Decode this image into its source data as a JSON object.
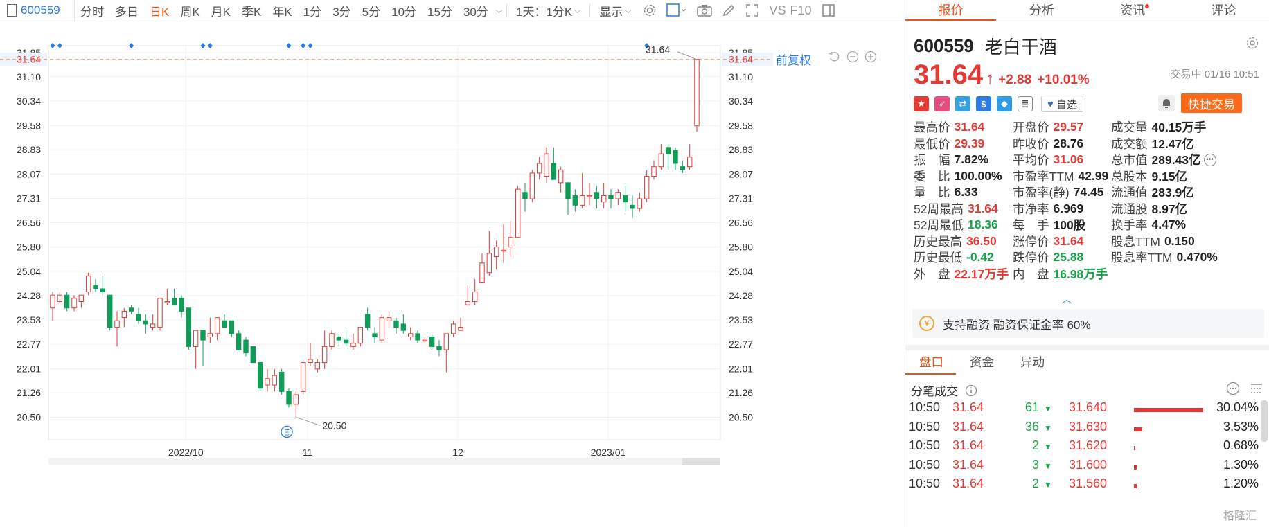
{
  "toolbar": {
    "code": "600559",
    "periods": [
      "分时",
      "多日",
      "日K",
      "周K",
      "月K",
      "季K",
      "年K",
      "1分",
      "3分",
      "5分",
      "10分",
      "15分",
      "30分"
    ],
    "active_period": "日K",
    "multi": "1天：1分K",
    "display": "显示",
    "vs": "VS",
    "f10": "F10"
  },
  "adjust_label": "前复权",
  "right": {
    "tabs": [
      "报价",
      "分析",
      "资讯",
      "评论"
    ],
    "code": "600559",
    "name": "老白干酒",
    "price": "31.64",
    "change": "+2.88",
    "pct": "+10.01%",
    "status": "交易中 01/16 10:51",
    "watch": "自选",
    "quick": "快捷交易",
    "margin_text": "支持融资 融资保证金率 60%",
    "margin_icon": "¥",
    "sub_tabs": [
      "盘口",
      "资金",
      "异动"
    ],
    "tick_title": "分笔成交",
    "watermark": "格隆汇"
  },
  "quote": [
    [
      {
        "k": "最高价",
        "v": "31.64",
        "c": "up"
      },
      {
        "k": "开盘价",
        "v": "29.57",
        "c": "up"
      },
      {
        "k": "成交量",
        "v": "40.15万手",
        "c": "nt"
      }
    ],
    [
      {
        "k": "最低价",
        "v": "29.39",
        "c": "up"
      },
      {
        "k": "昨收价",
        "v": "28.76",
        "c": "nt"
      },
      {
        "k": "成交额",
        "v": "12.47亿",
        "c": "nt"
      }
    ],
    [
      {
        "k": "振　幅",
        "v": "7.82%",
        "c": "nt"
      },
      {
        "k": "平均价",
        "v": "31.06",
        "c": "up"
      },
      {
        "k": "总市值",
        "v": "289.43亿",
        "c": "nt"
      }
    ],
    [
      {
        "k": "委　比",
        "v": "100.00%",
        "c": "nt"
      },
      {
        "k": "市盈率TTM",
        "v": "42.99",
        "c": "nt"
      },
      {
        "k": "总股本",
        "v": "9.15亿",
        "c": "nt"
      }
    ],
    [
      {
        "k": "量　比",
        "v": "6.33",
        "c": "nt"
      },
      {
        "k": "市盈率(静)",
        "v": "74.45",
        "c": "nt"
      },
      {
        "k": "流通值",
        "v": "283.9亿",
        "c": "nt"
      }
    ],
    [
      {
        "k": "52周最高",
        "v": "31.64",
        "c": "up"
      },
      {
        "k": "市净率",
        "v": "6.969",
        "c": "nt"
      },
      {
        "k": "流通股",
        "v": "8.97亿",
        "c": "nt"
      }
    ],
    [
      {
        "k": "52周最低",
        "v": "18.36",
        "c": "dn"
      },
      {
        "k": "每　手",
        "v": "100股",
        "c": "nt"
      },
      {
        "k": "换手率",
        "v": "4.47%",
        "c": "nt"
      }
    ],
    [
      {
        "k": "历史最高",
        "v": "36.50",
        "c": "up"
      },
      {
        "k": "涨停价",
        "v": "31.64",
        "c": "up"
      },
      {
        "k": "股息TTM",
        "v": "0.150",
        "c": "nt"
      }
    ],
    [
      {
        "k": "历史最低",
        "v": "-0.42",
        "c": "dn"
      },
      {
        "k": "跌停价",
        "v": "25.88",
        "c": "dn"
      },
      {
        "k": "股息率TTM",
        "v": "0.470%",
        "c": "nt"
      }
    ],
    [
      {
        "k": "外　盘",
        "v": "22.17万手",
        "c": "up"
      },
      {
        "k": "内　盘",
        "v": "16.98万手",
        "c": "dn"
      }
    ]
  ],
  "ticks": [
    {
      "time": "10:50",
      "price": "31.64",
      "vol": "61",
      "price2": "31.640",
      "pct": "30.04%",
      "bar": 0.3004
    },
    {
      "time": "10:50",
      "price": "31.64",
      "vol": "36",
      "price2": "31.630",
      "pct": "3.53%",
      "bar": 0.0353
    },
    {
      "time": "10:50",
      "price": "31.64",
      "vol": "2",
      "price2": "31.620",
      "pct": "0.68%",
      "bar": 0.0068
    },
    {
      "time": "10:50",
      "price": "31.64",
      "vol": "3",
      "price2": "31.600",
      "pct": "1.30%",
      "bar": 0.013
    },
    {
      "time": "10:50",
      "price": "31.64",
      "vol": "2",
      "price2": "31.560",
      "pct": "1.20%",
      "bar": 0.012
    }
  ],
  "chart_data": {
    "type": "candlestick",
    "y_ticks": [
      "31.85",
      "31.64",
      "31.10",
      "30.34",
      "29.58",
      "28.83",
      "28.07",
      "27.31",
      "26.56",
      "25.80",
      "25.04",
      "24.28",
      "23.53",
      "22.77",
      "22.01",
      "21.26",
      "20.50"
    ],
    "ylim": [
      20.1,
      31.85
    ],
    "x_labels": [
      {
        "label": "2022/10",
        "i": 19
      },
      {
        "label": "11",
        "i": 36
      },
      {
        "label": "12",
        "i": 57
      },
      {
        "label": "2023/01",
        "i": 78
      }
    ],
    "last_price": "31.64",
    "high_label": "31.64",
    "low_label": "20.50",
    "event_label": "E",
    "event_index": 33,
    "low_index": 34,
    "markers": [
      0,
      1,
      11,
      21,
      22,
      33,
      35,
      36,
      83
    ],
    "candles": [
      {
        "o": 23.9,
        "c": 24.3,
        "h": 24.4,
        "l": 23.5
      },
      {
        "o": 24.1,
        "c": 24.3,
        "h": 24.4,
        "l": 24.0
      },
      {
        "o": 24.3,
        "c": 23.9,
        "h": 24.4,
        "l": 23.8
      },
      {
        "o": 23.9,
        "c": 24.2,
        "h": 24.3,
        "l": 23.8
      },
      {
        "o": 24.1,
        "c": 24.3,
        "h": 24.3,
        "l": 23.9
      },
      {
        "o": 24.4,
        "c": 24.9,
        "h": 25.0,
        "l": 24.3
      },
      {
        "o": 24.6,
        "c": 24.5,
        "h": 24.8,
        "l": 24.4
      },
      {
        "o": 24.5,
        "c": 24.4,
        "h": 24.9,
        "l": 24.3
      },
      {
        "o": 24.3,
        "c": 23.3,
        "h": 24.3,
        "l": 23.2
      },
      {
        "o": 23.3,
        "c": 23.5,
        "h": 23.8,
        "l": 22.7
      },
      {
        "o": 23.6,
        "c": 23.8,
        "h": 23.9,
        "l": 23.3
      },
      {
        "o": 23.9,
        "c": 23.8,
        "h": 24.0,
        "l": 23.7
      },
      {
        "o": 23.7,
        "c": 23.5,
        "h": 23.9,
        "l": 23.4
      },
      {
        "o": 23.5,
        "c": 23.4,
        "h": 23.7,
        "l": 23.1
      },
      {
        "o": 23.3,
        "c": 23.4,
        "h": 23.7,
        "l": 23.2
      },
      {
        "o": 23.3,
        "c": 24.2,
        "h": 24.2,
        "l": 23.2
      },
      {
        "o": 24.1,
        "c": 24.1,
        "h": 24.5,
        "l": 24.0
      },
      {
        "o": 24.2,
        "c": 24.0,
        "h": 24.5,
        "l": 24.0
      },
      {
        "o": 24.2,
        "c": 23.8,
        "h": 24.3,
        "l": 23.6
      },
      {
        "o": 23.9,
        "c": 22.7,
        "h": 23.9,
        "l": 22.6
      },
      {
        "o": 22.7,
        "c": 23.2,
        "h": 23.2,
        "l": 22.0
      },
      {
        "o": 23.2,
        "c": 22.9,
        "h": 23.2,
        "l": 22.1
      },
      {
        "o": 23.0,
        "c": 23.1,
        "h": 23.6,
        "l": 22.8
      },
      {
        "o": 23.1,
        "c": 23.6,
        "h": 23.6,
        "l": 22.9
      },
      {
        "o": 23.5,
        "c": 23.3,
        "h": 23.7,
        "l": 23.3
      },
      {
        "o": 23.5,
        "c": 23.1,
        "h": 23.5,
        "l": 23.0
      },
      {
        "o": 23.1,
        "c": 22.6,
        "h": 23.2,
        "l": 22.6
      },
      {
        "o": 22.9,
        "c": 22.5,
        "h": 23.0,
        "l": 22.4
      },
      {
        "o": 22.7,
        "c": 22.2,
        "h": 22.7,
        "l": 22.2
      },
      {
        "o": 22.2,
        "c": 21.4,
        "h": 22.2,
        "l": 21.3
      },
      {
        "o": 21.5,
        "c": 21.7,
        "h": 22.0,
        "l": 21.3
      },
      {
        "o": 21.5,
        "c": 21.8,
        "h": 22.0,
        "l": 21.3
      },
      {
        "o": 21.9,
        "c": 21.3,
        "h": 22.0,
        "l": 21.2
      },
      {
        "o": 21.3,
        "c": 20.9,
        "h": 21.4,
        "l": 20.8
      },
      {
        "o": 20.9,
        "c": 21.2,
        "h": 21.3,
        "l": 20.5
      },
      {
        "o": 21.3,
        "c": 22.2,
        "h": 22.2,
        "l": 21.2
      },
      {
        "o": 22.2,
        "c": 22.3,
        "h": 22.8,
        "l": 22.1
      },
      {
        "o": 22.0,
        "c": 22.2,
        "h": 22.3,
        "l": 21.9
      },
      {
        "o": 22.2,
        "c": 22.7,
        "h": 23.2,
        "l": 22.0
      },
      {
        "o": 22.7,
        "c": 23.1,
        "h": 23.2,
        "l": 22.6
      },
      {
        "o": 23.0,
        "c": 22.9,
        "h": 23.1,
        "l": 22.7
      },
      {
        "o": 22.9,
        "c": 22.8,
        "h": 23.2,
        "l": 22.7
      },
      {
        "o": 22.7,
        "c": 22.8,
        "h": 23.1,
        "l": 22.6
      },
      {
        "o": 22.8,
        "c": 23.3,
        "h": 23.3,
        "l": 22.7
      },
      {
        "o": 23.7,
        "c": 23.3,
        "h": 23.9,
        "l": 23.2
      },
      {
        "o": 23.1,
        "c": 23.0,
        "h": 23.3,
        "l": 22.8
      },
      {
        "o": 22.9,
        "c": 23.6,
        "h": 23.7,
        "l": 22.8
      },
      {
        "o": 23.5,
        "c": 23.6,
        "h": 23.8,
        "l": 23.3
      },
      {
        "o": 23.5,
        "c": 23.3,
        "h": 23.6,
        "l": 23.1
      },
      {
        "o": 23.4,
        "c": 23.2,
        "h": 23.7,
        "l": 23.1
      },
      {
        "o": 23.0,
        "c": 23.1,
        "h": 23.3,
        "l": 22.9
      },
      {
        "o": 23.1,
        "c": 22.9,
        "h": 23.2,
        "l": 22.8
      },
      {
        "o": 22.9,
        "c": 22.9,
        "h": 23.0,
        "l": 22.8
      },
      {
        "o": 23.0,
        "c": 22.7,
        "h": 23.1,
        "l": 22.6
      },
      {
        "o": 22.7,
        "c": 22.6,
        "h": 22.9,
        "l": 22.4
      },
      {
        "o": 22.6,
        "c": 23.1,
        "h": 23.1,
        "l": 21.9
      },
      {
        "o": 23.1,
        "c": 23.4,
        "h": 23.5,
        "l": 23.0
      },
      {
        "o": 23.2,
        "c": 23.3,
        "h": 23.6,
        "l": 23.2
      },
      {
        "o": 24.0,
        "c": 24.1,
        "h": 24.6,
        "l": 24.0
      },
      {
        "o": 24.1,
        "c": 24.4,
        "h": 24.8,
        "l": 24.0
      },
      {
        "o": 24.7,
        "c": 25.3,
        "h": 25.6,
        "l": 24.7
      },
      {
        "o": 25.0,
        "c": 25.6,
        "h": 26.3,
        "l": 24.9
      },
      {
        "o": 25.5,
        "c": 25.8,
        "h": 26.0,
        "l": 25.1
      },
      {
        "o": 25.7,
        "c": 25.7,
        "h": 26.5,
        "l": 25.3
      },
      {
        "o": 25.8,
        "c": 26.1,
        "h": 26.6,
        "l": 25.5
      },
      {
        "o": 26.1,
        "c": 27.6,
        "h": 27.7,
        "l": 26.1
      },
      {
        "o": 27.5,
        "c": 27.3,
        "h": 27.8,
        "l": 26.9
      },
      {
        "o": 27.3,
        "c": 28.1,
        "h": 28.2,
        "l": 27.2
      },
      {
        "o": 28.1,
        "c": 28.4,
        "h": 28.6,
        "l": 27.9
      },
      {
        "o": 28.0,
        "c": 28.7,
        "h": 28.9,
        "l": 27.8
      },
      {
        "o": 28.4,
        "c": 27.9,
        "h": 28.9,
        "l": 27.9
      },
      {
        "o": 27.8,
        "c": 28.2,
        "h": 28.3,
        "l": 27.5
      },
      {
        "o": 27.8,
        "c": 27.3,
        "h": 27.8,
        "l": 26.8
      },
      {
        "o": 27.4,
        "c": 27.1,
        "h": 27.6,
        "l": 26.9
      },
      {
        "o": 27.1,
        "c": 27.4,
        "h": 28.1,
        "l": 27.0
      },
      {
        "o": 27.4,
        "c": 27.4,
        "h": 27.8,
        "l": 27.1
      },
      {
        "o": 27.5,
        "c": 27.3,
        "h": 27.7,
        "l": 27.0
      },
      {
        "o": 27.2,
        "c": 27.4,
        "h": 27.8,
        "l": 27.0
      },
      {
        "o": 27.4,
        "c": 27.3,
        "h": 27.6,
        "l": 27.0
      },
      {
        "o": 27.3,
        "c": 27.5,
        "h": 27.6,
        "l": 27.1
      },
      {
        "o": 27.4,
        "c": 27.2,
        "h": 27.7,
        "l": 26.9
      },
      {
        "o": 27.1,
        "c": 27.0,
        "h": 27.4,
        "l": 26.7
      },
      {
        "o": 27.0,
        "c": 27.3,
        "h": 27.5,
        "l": 26.9
      },
      {
        "o": 27.3,
        "c": 28.0,
        "h": 28.2,
        "l": 27.2
      },
      {
        "o": 28.0,
        "c": 28.3,
        "h": 28.5,
        "l": 27.9
      },
      {
        "o": 28.3,
        "c": 28.7,
        "h": 29.0,
        "l": 28.2
      },
      {
        "o": 28.9,
        "c": 28.7,
        "h": 29.0,
        "l": 28.2
      },
      {
        "o": 28.8,
        "c": 28.4,
        "h": 28.9,
        "l": 28.2
      },
      {
        "o": 28.3,
        "c": 28.2,
        "h": 28.5,
        "l": 28.1
      },
      {
        "o": 28.3,
        "c": 28.6,
        "h": 29.0,
        "l": 28.2
      },
      {
        "o": 29.57,
        "c": 31.64,
        "h": 31.64,
        "l": 29.39
      }
    ]
  }
}
